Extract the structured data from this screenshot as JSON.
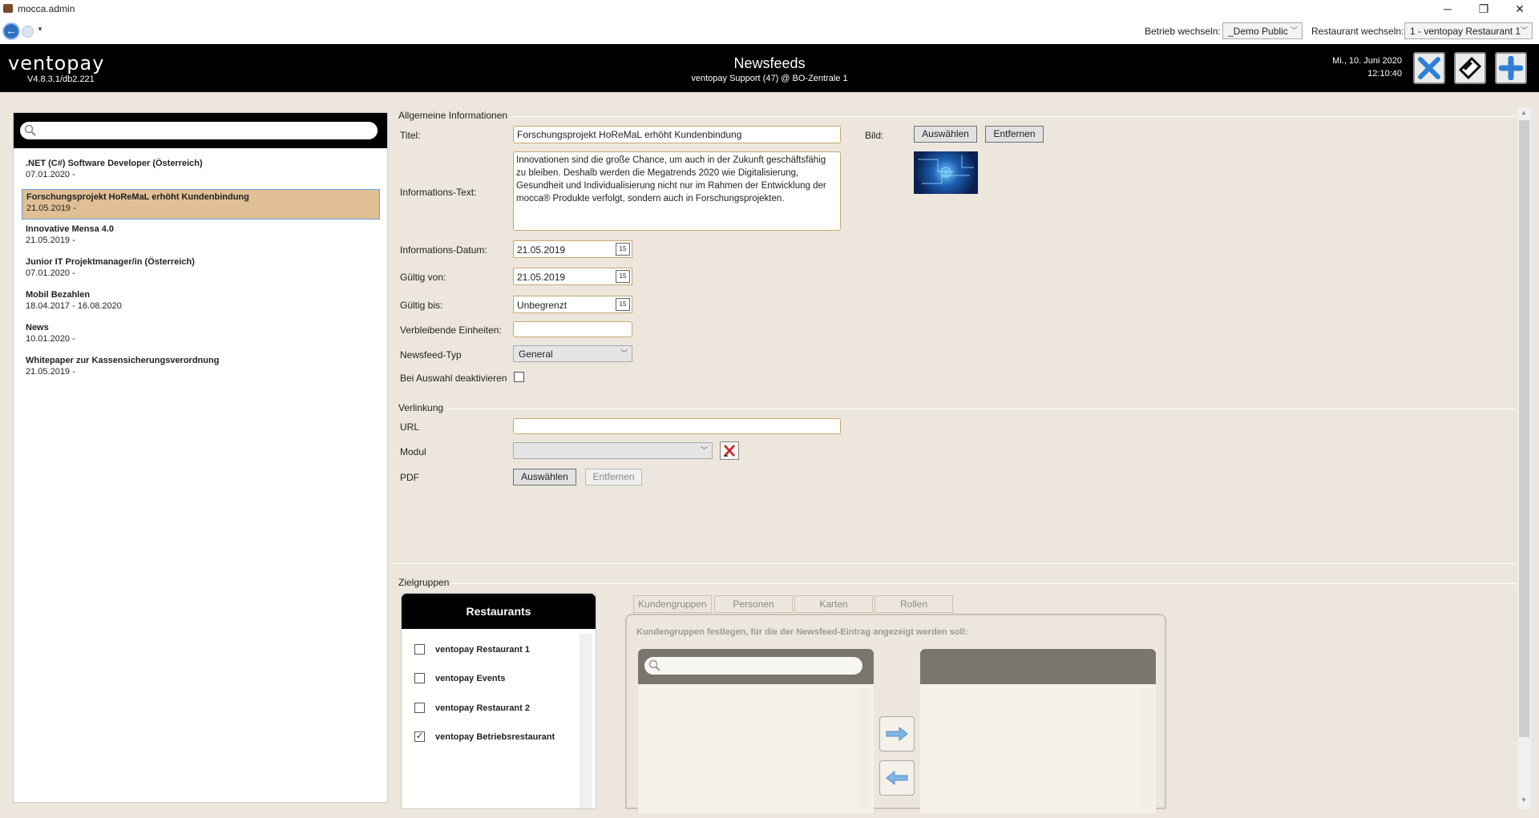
{
  "window": {
    "title": "mocca.admin",
    "minimize": "─",
    "restore": "❐",
    "close": "✕"
  },
  "nav": {
    "betrieb_label": "Betrieb wechseln:",
    "betrieb_value": "_Demo Public",
    "restaurant_label": "Restaurant wechseln:",
    "restaurant_value": "1 - ventopay Restaurant 1"
  },
  "header": {
    "logo": "ventopay",
    "version": "V4.8.3.1/db2.221",
    "page_title": "Newsfeeds",
    "subtitle": "ventopay Support (47) @ BO-Zentrale 1",
    "date": "Mi., 10. Juni 2020",
    "time": "12:10:40"
  },
  "list": {
    "search_placeholder": "",
    "items": [
      {
        "name": ".NET (C#) Software Developer (Österreich)",
        "dates": "07.01.2020 -"
      },
      {
        "name": "Forschungsprojekt HoReMaL erhöht Kundenbindung",
        "dates": "21.05.2019 -"
      },
      {
        "name": "Innovative Mensa 4.0",
        "dates": "21.05.2019 -"
      },
      {
        "name": "Junior IT Projektmanager/in (Österreich)",
        "dates": "07.01.2020 -"
      },
      {
        "name": "Mobil Bezahlen",
        "dates": "18.04.2017 - 16.08.2020"
      },
      {
        "name": "News",
        "dates": "10.01.2020 -"
      },
      {
        "name": "Whitepaper zur Kassensicherungsverordnung",
        "dates": "21.05.2019 -"
      }
    ]
  },
  "general": {
    "section": "Allgemeine Informationen",
    "title_label": "Titel:",
    "title_value": "Forschungsprojekt HoReMaL erhöht Kundenbindung",
    "image_label": "Bild:",
    "select_btn": "Auswählen",
    "remove_btn": "Entfernen",
    "info_label": "Informations-Text:",
    "info_text": "Innovationen sind die große Chance, um auch in der Zukunft geschäftsfähig zu bleiben. Deshalb werden die Megatrends 2020 wie Digitalisierung, Gesundheit und Individualisierung nicht nur im Rahmen der Entwicklung der mocca® Produkte verfolgt, sondern auch in Forschungsprojekten.",
    "info_date_label": "Informations-Datum:",
    "info_date": "21.05.2019",
    "valid_from_label": "Gültig von:",
    "valid_from": "21.05.2019",
    "valid_to_label": "Gültig bis:",
    "valid_to": "Unbegrenzt",
    "calendar_day": "15",
    "remaining_label": "Verbleibende Einheiten:",
    "remaining_value": "",
    "type_label": "Newsfeed-Typ",
    "type_value": "General",
    "deactivate_label": "Bei Auswahl deaktivieren"
  },
  "link": {
    "section": "Verlinkung",
    "url_label": "URL",
    "url_value": "",
    "module_label": "Modul",
    "module_value": "",
    "pdf_label": "PDF",
    "select_btn": "Auswählen",
    "remove_btn": "Entfernen"
  },
  "targets": {
    "section": "Zielgruppen",
    "restaurants_title": "Restaurants",
    "restaurants": [
      {
        "name": "ventopay Restaurant 1",
        "checked": false
      },
      {
        "name": "ventopay Events",
        "checked": false
      },
      {
        "name": "ventopay Restaurant 2",
        "checked": false
      },
      {
        "name": "ventopay Betriebsrestaurant",
        "checked": true
      }
    ],
    "tabs": [
      "Kundengruppen",
      "Personen",
      "Karten",
      "Rollen"
    ],
    "hint": "Kundengruppen festlegen, für die der Newsfeed-Eintrag angezeigt werden soll:"
  }
}
